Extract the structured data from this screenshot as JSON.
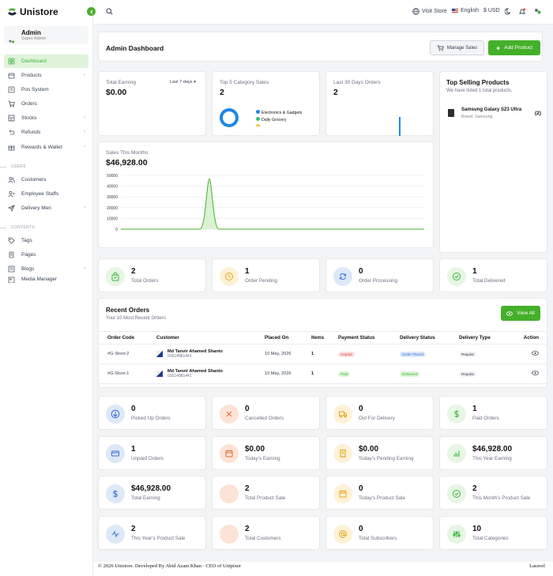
{
  "app": {
    "name": "Unistore"
  },
  "sidebar": {
    "profile": {
      "name": "Admin",
      "role": "Super Admin"
    },
    "items": [
      {
        "label": "Dashboard",
        "icon": "dashboard-icon"
      },
      {
        "label": "Products",
        "icon": "box-icon"
      },
      {
        "label": "Pos System",
        "icon": "pos-icon"
      },
      {
        "label": "Orders",
        "icon": "cart-icon"
      },
      {
        "label": "Stocks",
        "icon": "stock-icon"
      },
      {
        "label": "Refunds",
        "icon": "refund-icon"
      },
      {
        "label": "Rewards & Wallet",
        "icon": "gift-icon"
      },
      {
        "label": "Customers",
        "icon": "users-icon"
      },
      {
        "label": "Employee Staffs",
        "icon": "staff-icon"
      },
      {
        "label": "Delivery Men",
        "icon": "send-icon"
      },
      {
        "label": "Tags",
        "icon": "tag-icon"
      },
      {
        "label": "Pages",
        "icon": "pages-icon"
      },
      {
        "label": "Blogs",
        "icon": "blog-icon"
      },
      {
        "label": "Media Manager",
        "icon": "media-icon"
      }
    ],
    "sections": {
      "users": "USERS",
      "contents": "CONTENTS"
    }
  },
  "topbar": {
    "visit_store": "Visit Store",
    "language": "English",
    "currency": "$ USD"
  },
  "dashboard": {
    "title": "Admin Dashboard",
    "manage_sales": "Manage Sales",
    "add_product": "Add Product"
  },
  "widgets": {
    "total_earning": {
      "label": "Total Earning",
      "value": "$0.00",
      "period": "Last 7 days"
    },
    "top_category": {
      "label": "Top 5 Category Sales",
      "value": "2",
      "legend": [
        "Electronics & Gadgets",
        "Daily Grocery"
      ]
    },
    "last30": {
      "label": "Last 30 Days Orders",
      "value": "2"
    },
    "sales_month": {
      "label": "Sales This Months",
      "value": "$46,928.00"
    }
  },
  "chart_data": {
    "type": "area",
    "title": "Sales This Months",
    "y_ticks": [
      "50000",
      "40000",
      "30000",
      "20000",
      "10000",
      "0"
    ],
    "ylim": [
      0,
      50000
    ],
    "peak_value": 46928,
    "grid": true
  },
  "top_selling": {
    "title": "Top Selling Products",
    "subtitle": "We have listed 1 total products.",
    "items": [
      {
        "name": "Samsung Galaxy S23 Ultra",
        "brand": "Brand: Samsung",
        "count": "(2)"
      }
    ]
  },
  "order_stats": [
    {
      "num": "2",
      "label": "Total Orders",
      "color": "#e6f6e3",
      "fg": "#3bb33b",
      "icon": "bag-icon"
    },
    {
      "num": "1",
      "label": "Order Pending",
      "color": "#fdf1d6",
      "fg": "#e3a21a",
      "icon": "clock-icon"
    },
    {
      "num": "0",
      "label": "Order Processing",
      "color": "#dde8f8",
      "fg": "#3b6fd6",
      "icon": "refresh-icon"
    },
    {
      "num": "1",
      "label": "Total Delivered",
      "color": "#e6f6e3",
      "fg": "#3bb33b",
      "icon": "check-circle-icon"
    }
  ],
  "recent_orders": {
    "title": "Recent Orders",
    "subtitle": "Your 10 Most Recent Orders",
    "view_all": "View All",
    "columns": [
      "Order Code",
      "Customer",
      "Placed On",
      "Items",
      "Payment Status",
      "Delivery Status",
      "Delivery Type",
      "Action"
    ],
    "rows": [
      {
        "code": "#G-Store:2",
        "name": "Md Tanvir Ahamed Shanto",
        "phone": "01614081441",
        "placed": "10 May, 2026",
        "items": "1",
        "payment": "Unpaid",
        "delivery": "Order Placed",
        "type": "Regular"
      },
      {
        "code": "#G-Store:1",
        "name": "Md Tanvir Ahamed Shanto",
        "phone": "01614081441",
        "placed": "10 May, 2026",
        "items": "1",
        "payment": "Paid",
        "delivery": "Delivered",
        "type": "Regular"
      }
    ]
  },
  "stats": [
    {
      "num": "0",
      "label": "Picked Up Orders",
      "color": "#dde8f8",
      "fg": "#3b6fd6",
      "icon": "arrow-down-icon"
    },
    {
      "num": "0",
      "label": "Cancelled Orders",
      "color": "#fde3d6",
      "fg": "#e56a2c",
      "icon": "x-icon"
    },
    {
      "num": "0",
      "label": "Out For Delivery",
      "color": "#fdf1d6",
      "fg": "#e3a21a",
      "icon": "truck-icon"
    },
    {
      "num": "1",
      "label": "Paid Orders",
      "color": "#e6f6e3",
      "fg": "#3bb33b",
      "icon": "dollar-icon"
    },
    {
      "num": "1",
      "label": "Unpaid Orders",
      "color": "#dde8f8",
      "fg": "#3b6fd6",
      "icon": "card-icon"
    },
    {
      "num": "$0.00",
      "label": "Today's Earning",
      "color": "#fde3d6",
      "fg": "#e56a2c",
      "icon": "calendar-icon"
    },
    {
      "num": "$0.00",
      "label": "Today's Pending Earning",
      "color": "#fdf1d6",
      "fg": "#e3a21a",
      "icon": "receipt-icon"
    },
    {
      "num": "$46,928.00",
      "label": "This Year Earning",
      "color": "#e6f6e3",
      "fg": "#3bb33b",
      "icon": "bar-chart-icon"
    },
    {
      "num": "$46,928.00",
      "label": "Total Earning",
      "color": "#dde8f8",
      "fg": "#3b6fd6",
      "icon": "dollar-icon"
    },
    {
      "num": "2",
      "label": "Total Product Sale",
      "color": "#fde3d6",
      "fg": "#e56a2c",
      "icon": "cart-icon"
    },
    {
      "num": "0",
      "label": "Today's Product Sale",
      "color": "#fdf1d6",
      "fg": "#e3a21a",
      "icon": "calendar-icon"
    },
    {
      "num": "2",
      "label": "This Month's Product Sale",
      "color": "#e6f6e3",
      "fg": "#3bb33b",
      "icon": "check-circle-icon"
    },
    {
      "num": "2",
      "label": "This Year's Product Sale",
      "color": "#dde8f8",
      "fg": "#3b6fd6",
      "icon": "activity-icon"
    },
    {
      "num": "2",
      "label": "Total Customers",
      "color": "#fde3d6",
      "fg": "#e56a2c",
      "icon": "users-icon"
    },
    {
      "num": "0",
      "label": "Total Subscribers",
      "color": "#fdf1d6",
      "fg": "#e3a21a",
      "icon": "at-icon"
    },
    {
      "num": "10",
      "label": "Total Categories",
      "color": "#e6f6e3",
      "fg": "#3bb33b",
      "icon": "sliders-icon"
    }
  ],
  "footer": {
    "copyright": "© 2026 Unistore. Developed By Abid Azam Khan · CEO of Unipixer",
    "framework": "Laravel"
  }
}
